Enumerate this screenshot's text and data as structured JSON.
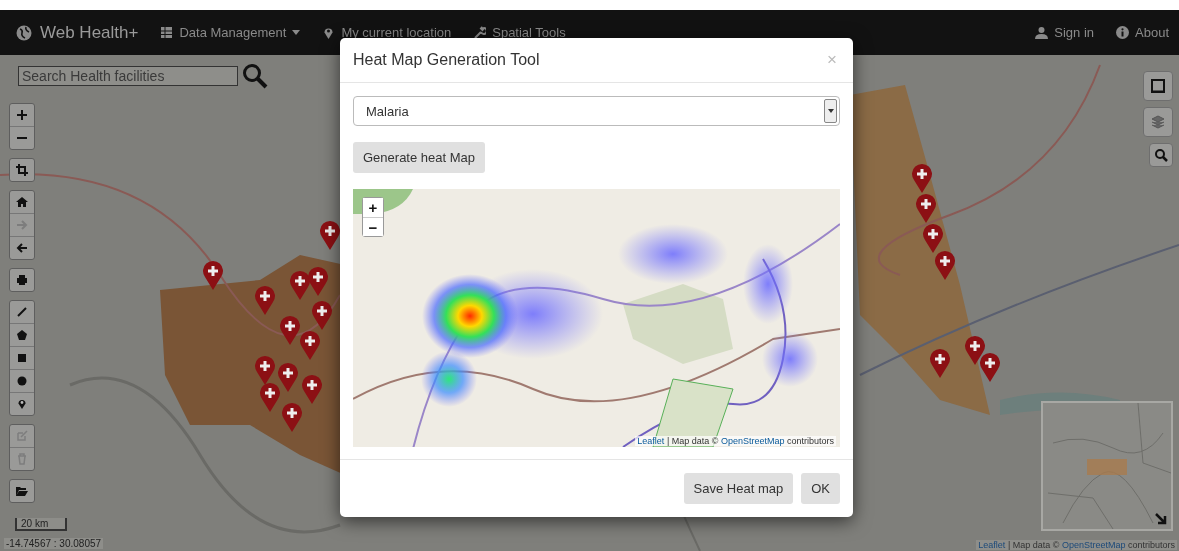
{
  "navbar": {
    "brand": "Web Health+",
    "items": [
      {
        "label": "Data Management",
        "dropdown": true
      },
      {
        "label": "My current location",
        "dropdown": false
      },
      {
        "label": "Spatial Tools",
        "dropdown": false
      }
    ],
    "right_items": [
      {
        "label": "Sign in"
      },
      {
        "label": "About"
      }
    ]
  },
  "search": {
    "placeholder": "Search Health facilities"
  },
  "map": {
    "tools": [
      [
        {
          "disabled": false
        },
        {
          "disabled": false
        }
      ],
      [
        {
          "disabled": false
        }
      ],
      [
        {
          "disabled": false
        },
        {
          "disabled": true
        },
        {
          "disabled": false
        }
      ],
      [
        {
          "disabled": false
        }
      ],
      [
        {
          "disabled": false
        },
        {
          "disabled": false
        },
        {
          "disabled": false
        },
        {
          "disabled": false
        },
        {
          "disabled": false
        }
      ],
      [
        {
          "disabled": true
        },
        {
          "disabled": true
        }
      ],
      [
        {
          "disabled": false
        }
      ]
    ],
    "scale": "20 km",
    "coordinates": "-14.74567 : 30.08057",
    "attribution": {
      "library": "Leaflet",
      "text": "| Map data ©",
      "source": "OpenStreetMap",
      "suffix": "contributors"
    }
  },
  "dialog": {
    "title": "Heat Map Generation Tool",
    "close": "×",
    "select": {
      "value": "Malaria"
    },
    "generate_button": "Generate heat Map",
    "map": {
      "zoom_in": "+",
      "zoom_out": "−",
      "attribution": {
        "library": "Leaflet",
        "text": "| Map data ©",
        "source": "OpenStreetMap",
        "suffix": "contributors"
      }
    },
    "buttons": [
      "Save Heat map",
      "OK"
    ]
  }
}
